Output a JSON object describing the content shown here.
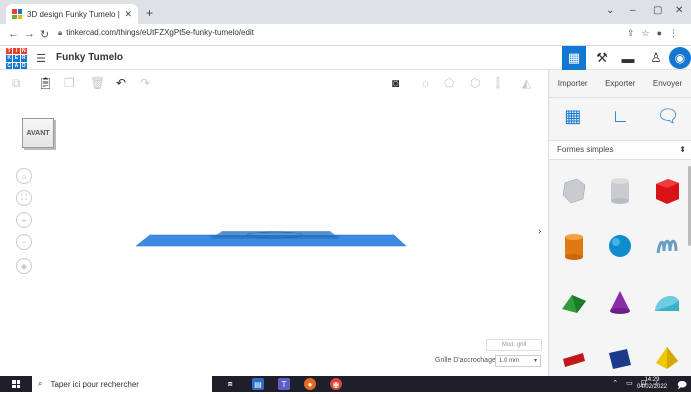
{
  "browser": {
    "tab_title": "3D design Funky Tumelo | Tinker",
    "tab_close": "✕",
    "new_tab": "+",
    "url": "tinkercad.com/things/eUtFZXgPt5e-funky-tumelo/edit",
    "window_min": "⌄",
    "window_minimize": "–",
    "window_restore": "▢",
    "window_close": "✕"
  },
  "app": {
    "logo_letters": [
      "T",
      "I",
      "N",
      "K",
      "E",
      "R",
      "C",
      "A",
      "D"
    ],
    "design_name": "Funky Tumelo",
    "brand_color": "#1477d1"
  },
  "panel": {
    "import_label": "Importer",
    "export_label": "Exporter",
    "send_label": "Envoyer",
    "shape_category": "Formes simples"
  },
  "workplane": {
    "viewcube_label": "AVANT",
    "mod_grid_label": "Mod. grill",
    "snap_label": "Grille D'accrochage",
    "snap_value": "1.0 mm"
  },
  "taskbar": {
    "search_placeholder": "Taper ici pour rechercher",
    "time": "14:29",
    "date": "04/02/2022"
  }
}
